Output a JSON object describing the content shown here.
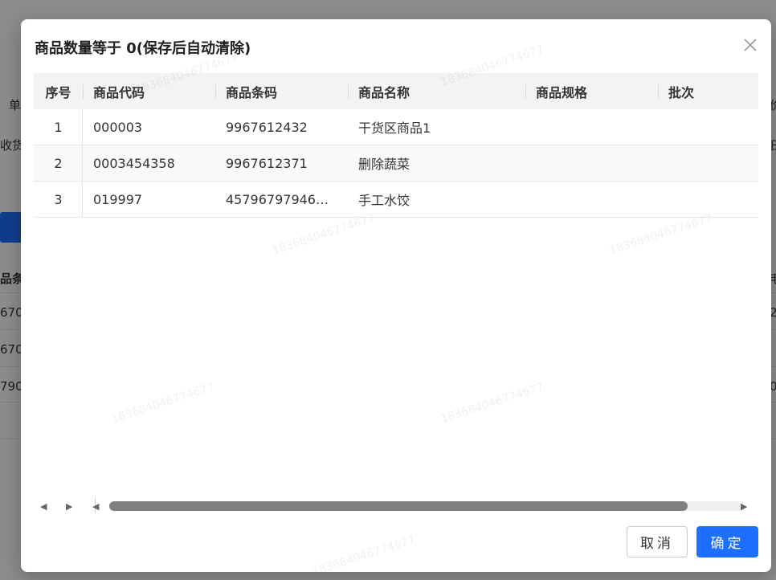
{
  "background": {
    "labels": [
      "单",
      "收货",
      "品条",
      "670",
      "670",
      "790"
    ],
    "right_labels": [
      "价",
      "日",
      "毛",
      "2",
      "0"
    ]
  },
  "modal": {
    "title": "商品数量等于 0(保存后自动清除)",
    "columns": [
      "序号",
      "商品代码",
      "商品条码",
      "商品名称",
      "商品规格",
      "批次"
    ],
    "rows": [
      {
        "idx": "1",
        "code": "000003",
        "barcode": "9967612432",
        "name": "干货区商品1",
        "spec": "",
        "batch": ""
      },
      {
        "idx": "2",
        "code": "0003454358",
        "barcode": "9967612371",
        "name": "删除蔬菜",
        "spec": "",
        "batch": ""
      },
      {
        "idx": "3",
        "code": "019997",
        "barcode": "45796797946…",
        "name": "手工水饺",
        "spec": "",
        "batch": ""
      }
    ],
    "cancel_label": "取消",
    "ok_label": "确定",
    "watermark": "18368404677467​7"
  }
}
